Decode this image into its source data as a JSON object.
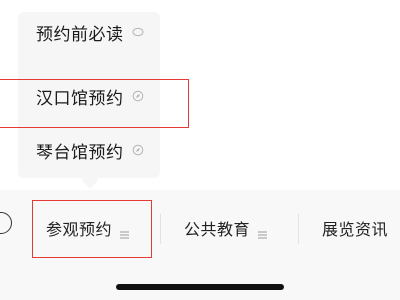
{
  "popup_menu": {
    "items": [
      {
        "label": "预约前必读",
        "icon": "circle-outline-icon"
      },
      {
        "label": "汉口馆预约",
        "icon": "compass-icon"
      },
      {
        "label": "琴台馆预约",
        "icon": "compass-icon"
      }
    ]
  },
  "tab_bar": {
    "tabs": [
      {
        "label": "参观预约",
        "icon": "menu-lines-icon"
      },
      {
        "label": "公共教育",
        "icon": "menu-lines-icon"
      },
      {
        "label": "展览资讯"
      }
    ]
  },
  "colors": {
    "highlight": "#e53935",
    "menu_background": "#f6f6f6",
    "tab_bar_background": "#f8f8f8"
  }
}
